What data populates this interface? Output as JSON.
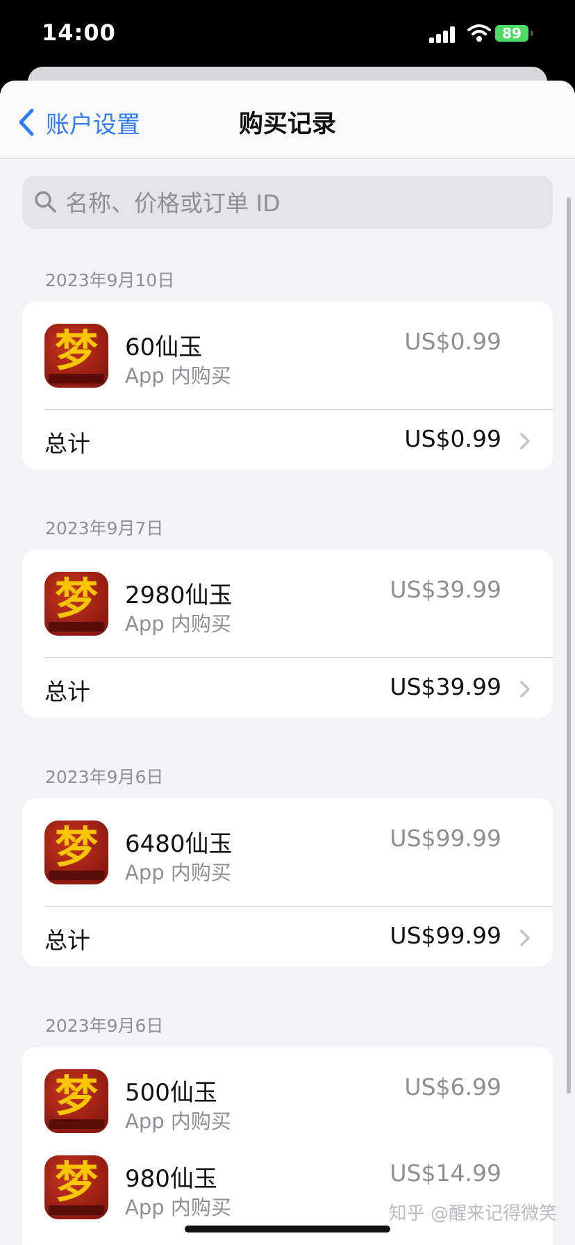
{
  "status": {
    "time": "14:00",
    "battery": "89"
  },
  "nav": {
    "back_label": "账户设置",
    "title": "购买记录"
  },
  "search": {
    "placeholder": "名称、价格或订单 ID"
  },
  "sections": [
    {
      "date": "2023年9月10日",
      "items": [
        {
          "name": "60仙玉",
          "type": "App 内购买",
          "price": "US$0.99"
        }
      ],
      "total_label": "总计",
      "total": "US$0.99"
    },
    {
      "date": "2023年9月7日",
      "items": [
        {
          "name": "2980仙玉",
          "type": "App 内购买",
          "price": "US$39.99"
        }
      ],
      "total_label": "总计",
      "total": "US$39.99"
    },
    {
      "date": "2023年9月6日",
      "items": [
        {
          "name": "6480仙玉",
          "type": "App 内购买",
          "price": "US$99.99"
        }
      ],
      "total_label": "总计",
      "total": "US$99.99"
    },
    {
      "date": "2023年9月6日",
      "items": [
        {
          "name": "500仙玉",
          "type": "App 内购买",
          "price": "US$6.99"
        },
        {
          "name": "980仙玉",
          "type": "App 内购买",
          "price": "US$14.99"
        }
      ]
    }
  ],
  "watermark": "知乎 @醒来记得微笑",
  "colors": {
    "accent": "#2f7cf6",
    "background": "#f2f2f7",
    "battery": "#4cd964",
    "icon": "#b2291b"
  }
}
